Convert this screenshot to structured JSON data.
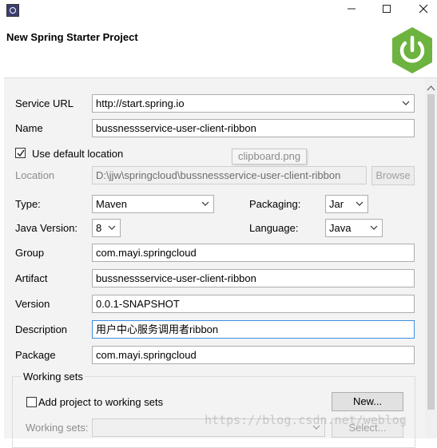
{
  "window": {
    "title_bar": {
      "app_icon": "eclipse-app-icon",
      "buttons": [
        "minimize-icon",
        "maximize-icon",
        "close-icon"
      ]
    },
    "header": {
      "title": "New Spring Starter Project",
      "logo": "spring-power-icon",
      "logo_color": "#6db33f"
    }
  },
  "form": {
    "service_url": {
      "label": "Service URL",
      "value": "http://start.spring.io"
    },
    "name": {
      "label": "Name",
      "value": "bussnessservice-user-client-ribbon"
    },
    "use_default_location": {
      "label": "Use default location",
      "checked": true
    },
    "location": {
      "label": "Location",
      "value": "D:\\jjw\\springcloud\\bussnessservice-user-client-ribbon",
      "browse_label": "Browse"
    },
    "type": {
      "label": "Type:",
      "value": "Maven"
    },
    "packaging": {
      "label": "Packaging:",
      "value": "Jar"
    },
    "java_version": {
      "label": "Java Version:",
      "value": "8"
    },
    "language": {
      "label": "Language:",
      "value": "Java"
    },
    "group": {
      "label": "Group",
      "value": "com.mayi.springcloud"
    },
    "artifact": {
      "label": "Artifact",
      "value": "bussnessservice-user-client-ribbon"
    },
    "version": {
      "label": "Version",
      "value": "0.0.1-SNAPSHOT"
    },
    "description": {
      "label": "Description",
      "value": "用户中心服务调用者ribbon"
    },
    "package": {
      "label": "Package",
      "value": "com.mayi.springcloud"
    },
    "working_sets": {
      "legend": "Working sets",
      "add_label": "Add project to working sets",
      "add_checked": false,
      "new_button": "New...",
      "sets_label": "Working sets:",
      "select_button": "Select..."
    }
  },
  "tooltip": {
    "text": "clipboard.png"
  },
  "watermark": {
    "text": "https://blog.csdn.net/weblog"
  },
  "colors": {
    "accent_focus": "#3c8ee0",
    "panel_bg": "#f3f3f3"
  }
}
